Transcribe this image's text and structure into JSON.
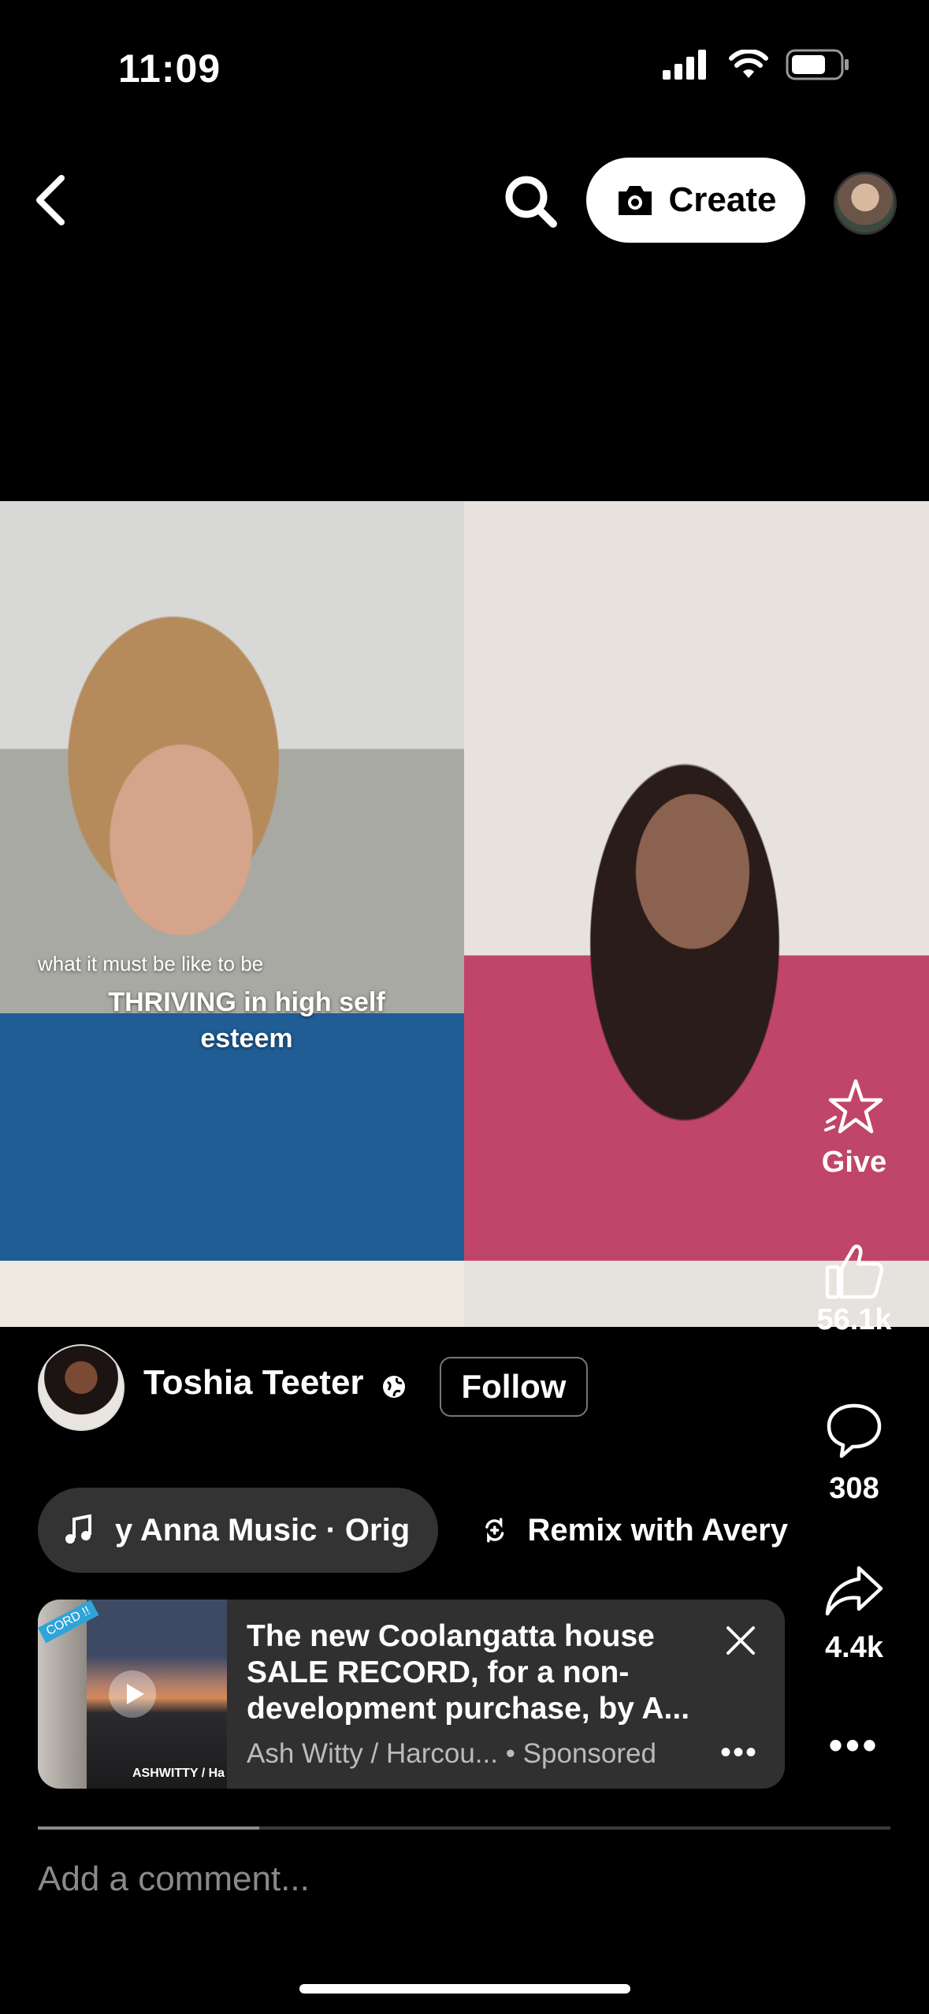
{
  "status_bar": {
    "time": "11:09"
  },
  "header": {
    "create_label": "Create"
  },
  "video": {
    "caption_small": "what it must be like to be",
    "caption_big": "THRIVING in high self esteem",
    "progress": 0.26
  },
  "actions": {
    "give_label": "Give",
    "likes": "56.1k",
    "comments": "308",
    "shares": "4.4k"
  },
  "creator": {
    "name": "Toshia Teeter",
    "follow_label": "Follow"
  },
  "audio": {
    "music_label": "y Anna Music · Orig",
    "remix_label": "Remix with Avery"
  },
  "ad": {
    "title": "The new Coolangatta house SALE RECORD, for a non-development purchase, by A...",
    "advertiser": "Ash Witty / Harcou...",
    "sponsored_label": "• Sponsored",
    "thumb_badge": "CORD !!",
    "thumb_watermark": "ASHWITTY / Ha"
  },
  "comment": {
    "placeholder": "Add a comment..."
  },
  "icons": {
    "back": "chevron-left-icon",
    "search": "search-icon",
    "camera": "camera-icon",
    "give": "star-gift-icon",
    "like": "thumbs-up-icon",
    "comment": "comment-bubble-icon",
    "share": "share-arrow-icon",
    "more": "more-horizontal-icon",
    "music": "music-note-icon",
    "remix": "remix-icon",
    "globe": "globe-icon",
    "close": "close-icon"
  }
}
